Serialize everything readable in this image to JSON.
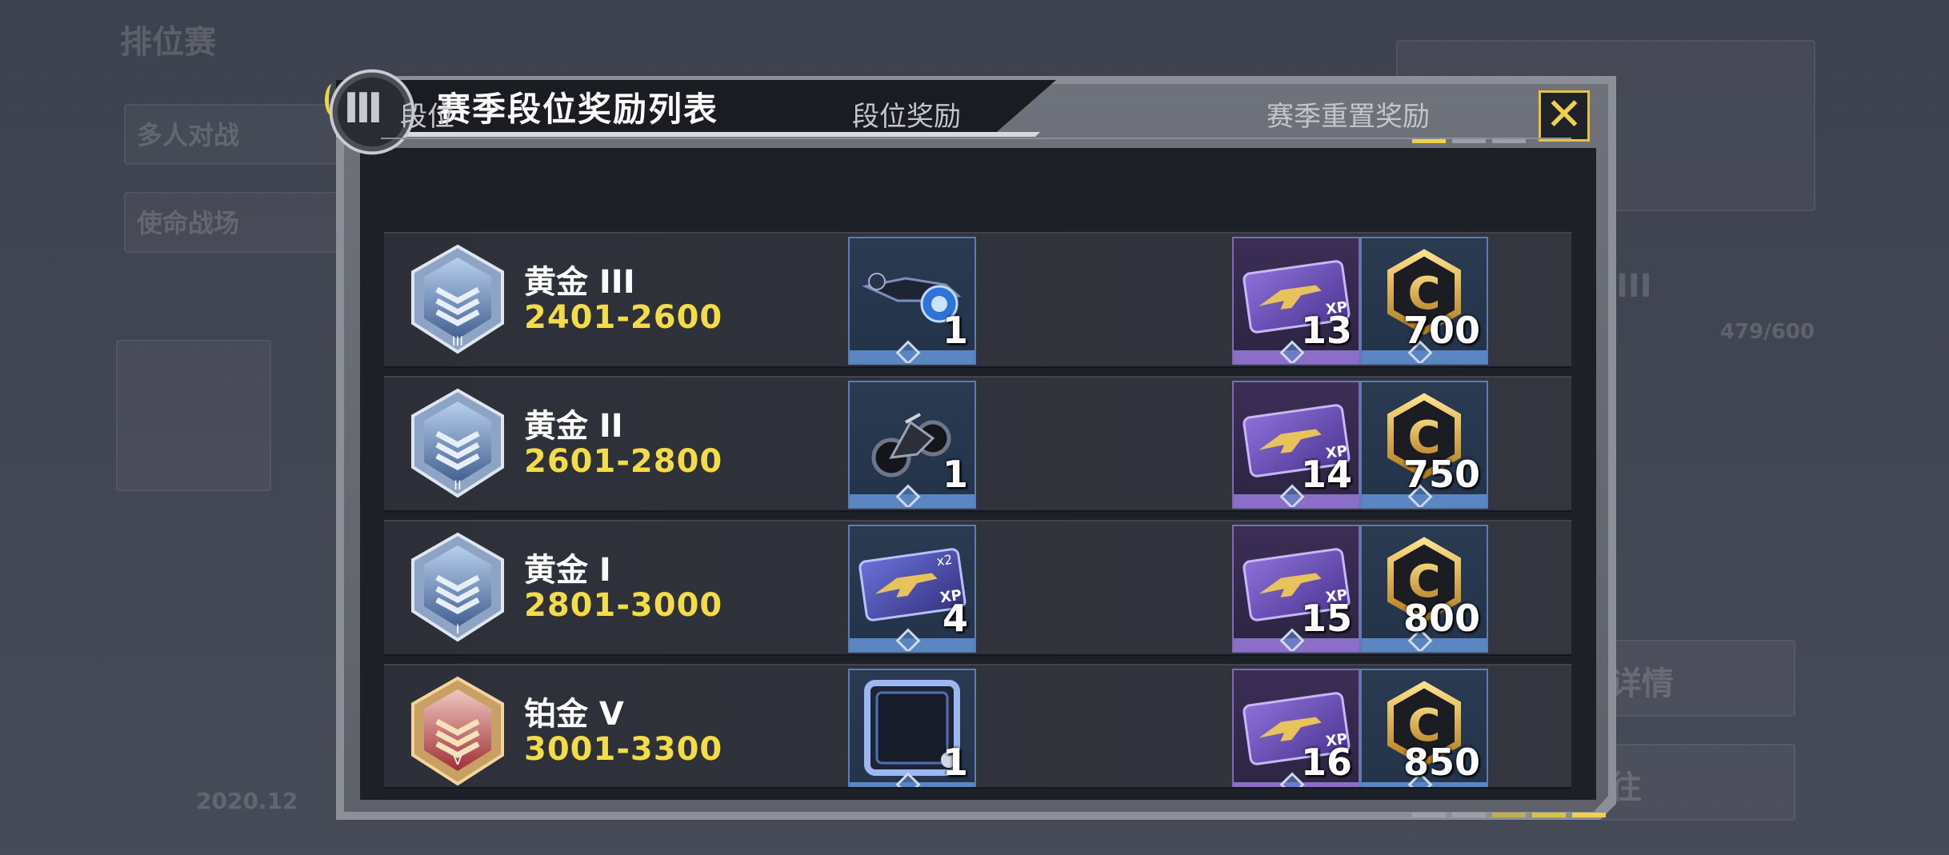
{
  "background": {
    "mode_label": "排位赛",
    "tab_multiplayer": "多人对战",
    "tab_battle_royale": "使命战场",
    "detail_label": "详情",
    "go_label": "往",
    "rank_suffix": "III",
    "progress": "479/600",
    "season_label": "2020.12"
  },
  "modal": {
    "title": "赛季段位奖励列表",
    "close_icon": "close-icon",
    "page_indicator_top": {
      "total": 3,
      "active": 0
    },
    "page_indicator_bottom": {
      "total": 5,
      "active": [
        2,
        3,
        4
      ]
    },
    "columns": [
      "段位",
      "段位奖励",
      "赛季重置奖励"
    ],
    "rows": [
      {
        "rank": "黄金 III",
        "range": "2401-2600",
        "emblem": "gold-rank-emblem",
        "reward": {
          "icon": "drone-icon",
          "qty": "1"
        },
        "reset_xp": {
          "icon": "weapon-xp-card-icon",
          "qty": "13"
        },
        "reset_credits": {
          "icon": "credit-coin-icon",
          "qty": "700"
        }
      },
      {
        "rank": "黄金 II",
        "range": "2601-2800",
        "emblem": "gold-rank-emblem",
        "reward": {
          "icon": "motorcycle-icon",
          "qty": "1"
        },
        "reset_xp": {
          "icon": "weapon-xp-card-icon",
          "qty": "14"
        },
        "reset_credits": {
          "icon": "credit-coin-icon",
          "qty": "750"
        }
      },
      {
        "rank": "黄金 I",
        "range": "2801-3000",
        "emblem": "gold-rank-emblem",
        "reward": {
          "icon": "double-weapon-xp-card-icon",
          "qty": "4",
          "multiplier": "x2"
        },
        "reset_xp": {
          "icon": "weapon-xp-card-icon",
          "qty": "15"
        },
        "reset_credits": {
          "icon": "credit-coin-icon",
          "qty": "800"
        }
      },
      {
        "rank": "铂金 V",
        "range": "3001-3300",
        "emblem": "platinum-rank-emblem",
        "reward": {
          "icon": "avatar-frame-icon",
          "qty": "1"
        },
        "reset_xp": {
          "icon": "weapon-xp-card-icon",
          "qty": "16"
        },
        "reset_credits": {
          "icon": "credit-coin-icon",
          "qty": "850"
        }
      }
    ]
  },
  "colors": {
    "accent_yellow": "#f3dc46",
    "tile_blue": "#5a86c4",
    "tile_purple": "#8a6ec8",
    "platinum_red": "#b8333a"
  }
}
